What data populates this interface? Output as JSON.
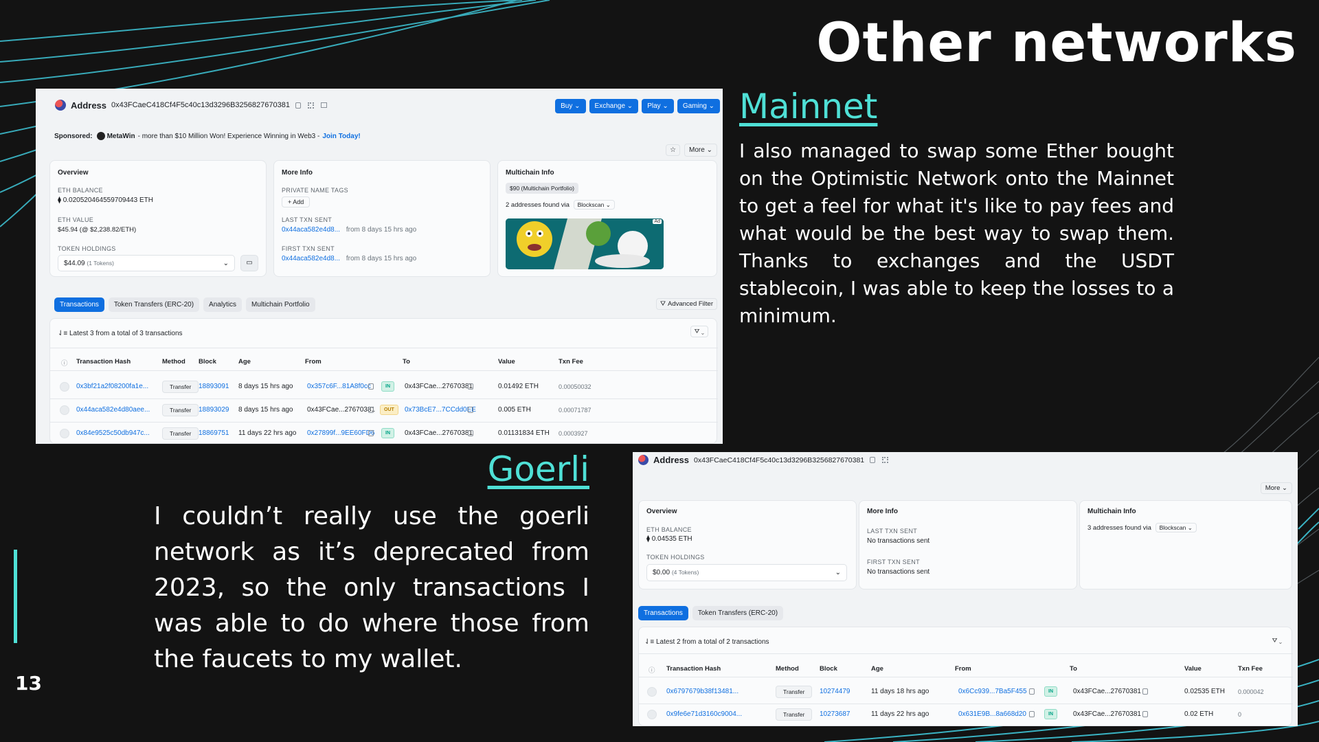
{
  "slide": {
    "title": "Other networks",
    "page_number": "13",
    "mainnet": {
      "heading": "Mainnet",
      "text": "I also managed to swap some Ether bought on the Optimistic Network onto the Mainnet to get a feel for what it's like to pay fees and what would be the best way to swap them. Thanks to exchanges and the USDT stablecoin, I was able to keep the losses to a minimum."
    },
    "goerli": {
      "heading": "Goerli",
      "text": "I couldn’t really use the goerli network as it’s deprecated from 2023, so the only transactions I was able to do where those from the faucets to my wallet."
    },
    "colors": {
      "accent": "#4fe0d6",
      "background": "#131313"
    }
  },
  "mainnet_shot": {
    "address_label": "Address",
    "address": "0x43FCaeC418Cf4F5c40c13d3296B3256827670381",
    "buttons": [
      "Buy",
      "Exchange",
      "Play",
      "Gaming"
    ],
    "sponsored_label": "Sponsored:",
    "sponsor_name": "MetaWin",
    "sponsor_text": "- more than $10 Million Won! Experience Winning in Web3 -",
    "sponsor_cta": "Join Today!",
    "more_label": "More",
    "overview": {
      "title": "Overview",
      "eth_balance_label": "ETH BALANCE",
      "eth_balance": "⧫ 0.020520464559709443 ETH",
      "eth_value_label": "ETH VALUE",
      "eth_value": "$45.94 (@ $2,238.82/ETH)",
      "token_holdings_label": "TOKEN HOLDINGS",
      "token_holdings_value": "$44.09",
      "token_holdings_count": "(1 Tokens)"
    },
    "more_info": {
      "title": "More Info",
      "private_tags_label": "PRIVATE NAME TAGS",
      "add_label": "+ Add",
      "last_txn_label": "LAST TXN SENT",
      "last_txn_hash": "0x44aca582e4d8...",
      "last_txn_age": "from 8 days 15 hrs ago",
      "first_txn_label": "FIRST TXN SENT",
      "first_txn_hash": "0x44aca582e4d8...",
      "first_txn_age": "from 8 days 15 hrs ago"
    },
    "multichain": {
      "title": "Multichain Info",
      "badge": "$90 (Multichain Portfolio)",
      "found_text": "2 addresses found via",
      "found_via": "Blockscan",
      "ad_label": "Ad"
    },
    "tabs": [
      "Transactions",
      "Token Transfers (ERC-20)",
      "Analytics",
      "Multichain Portfolio"
    ],
    "advanced_filter": "Advanced Filter",
    "summary": "Latest 3 from a total of 3 transactions",
    "columns": [
      "Transaction Hash",
      "Method",
      "Block",
      "Age",
      "From",
      "To",
      "Value",
      "Txn Fee"
    ],
    "rows": [
      {
        "hash": "0x3bf21a2f08200fa1e...",
        "method": "Transfer",
        "block": "18893091",
        "age": "8 days 15 hrs ago",
        "from": "0x357c6F...81A8f0cc",
        "dir": "IN",
        "to": "0x43FCae...27670381",
        "value": "0.01492 ETH",
        "fee": "0.00050032"
      },
      {
        "hash": "0x44aca582e4d80aee...",
        "method": "Transfer",
        "block": "18893029",
        "age": "8 days 15 hrs ago",
        "from": "0x43FCae...27670381",
        "dir": "OUT",
        "to": "0x73BcE7...7CCdd0EE",
        "value": "0.005 ETH",
        "fee": "0.00071787"
      },
      {
        "hash": "0x84e9525c50db947c...",
        "method": "Transfer",
        "block": "18869751",
        "age": "11 days 22 hrs ago",
        "from": "0x27899f...9EE60FD6",
        "dir": "IN",
        "to": "0x43FCae...27670381",
        "value": "0.01131834 ETH",
        "fee": "0.0003927"
      }
    ]
  },
  "goerli_shot": {
    "address_label": "Address",
    "address": "0x43FCaeC418Cf4F5c40c13d3296B3256827670381",
    "more_label": "More",
    "overview": {
      "title": "Overview",
      "eth_balance_label": "ETH BALANCE",
      "eth_balance": "⧫ 0.04535 ETH",
      "token_holdings_label": "TOKEN HOLDINGS",
      "token_holdings_value": "$0.00",
      "token_holdings_count": "(4 Tokens)"
    },
    "more_info": {
      "title": "More Info",
      "last_txn_label": "LAST TXN SENT",
      "last_txn": "No transactions sent",
      "first_txn_label": "FIRST TXN SENT",
      "first_txn": "No transactions sent"
    },
    "multichain": {
      "title": "Multichain Info",
      "found_text": "3 addresses found via",
      "found_via": "Blockscan"
    },
    "tabs": [
      "Transactions",
      "Token Transfers (ERC-20)"
    ],
    "summary": "Latest 2 from a total of 2 transactions",
    "columns": [
      "Transaction Hash",
      "Method",
      "Block",
      "Age",
      "From",
      "To",
      "Value",
      "Txn Fee"
    ],
    "rows": [
      {
        "hash": "0x6797679b38f13481...",
        "method": "Transfer",
        "block": "10274479",
        "age": "11 days 18 hrs ago",
        "from": "0x6Cc939...7Ba5F455",
        "dir": "IN",
        "to": "0x43FCae...27670381",
        "value": "0.02535 ETH",
        "fee": "0.000042"
      },
      {
        "hash": "0x9fe6e71d3160c9004...",
        "method": "Transfer",
        "block": "10273687",
        "age": "11 days 22 hrs ago",
        "from": "0x631E9B...8a668d20",
        "dir": "IN",
        "to": "0x43FCae...27670381",
        "value": "0.02 ETH",
        "fee": "0"
      }
    ]
  }
}
